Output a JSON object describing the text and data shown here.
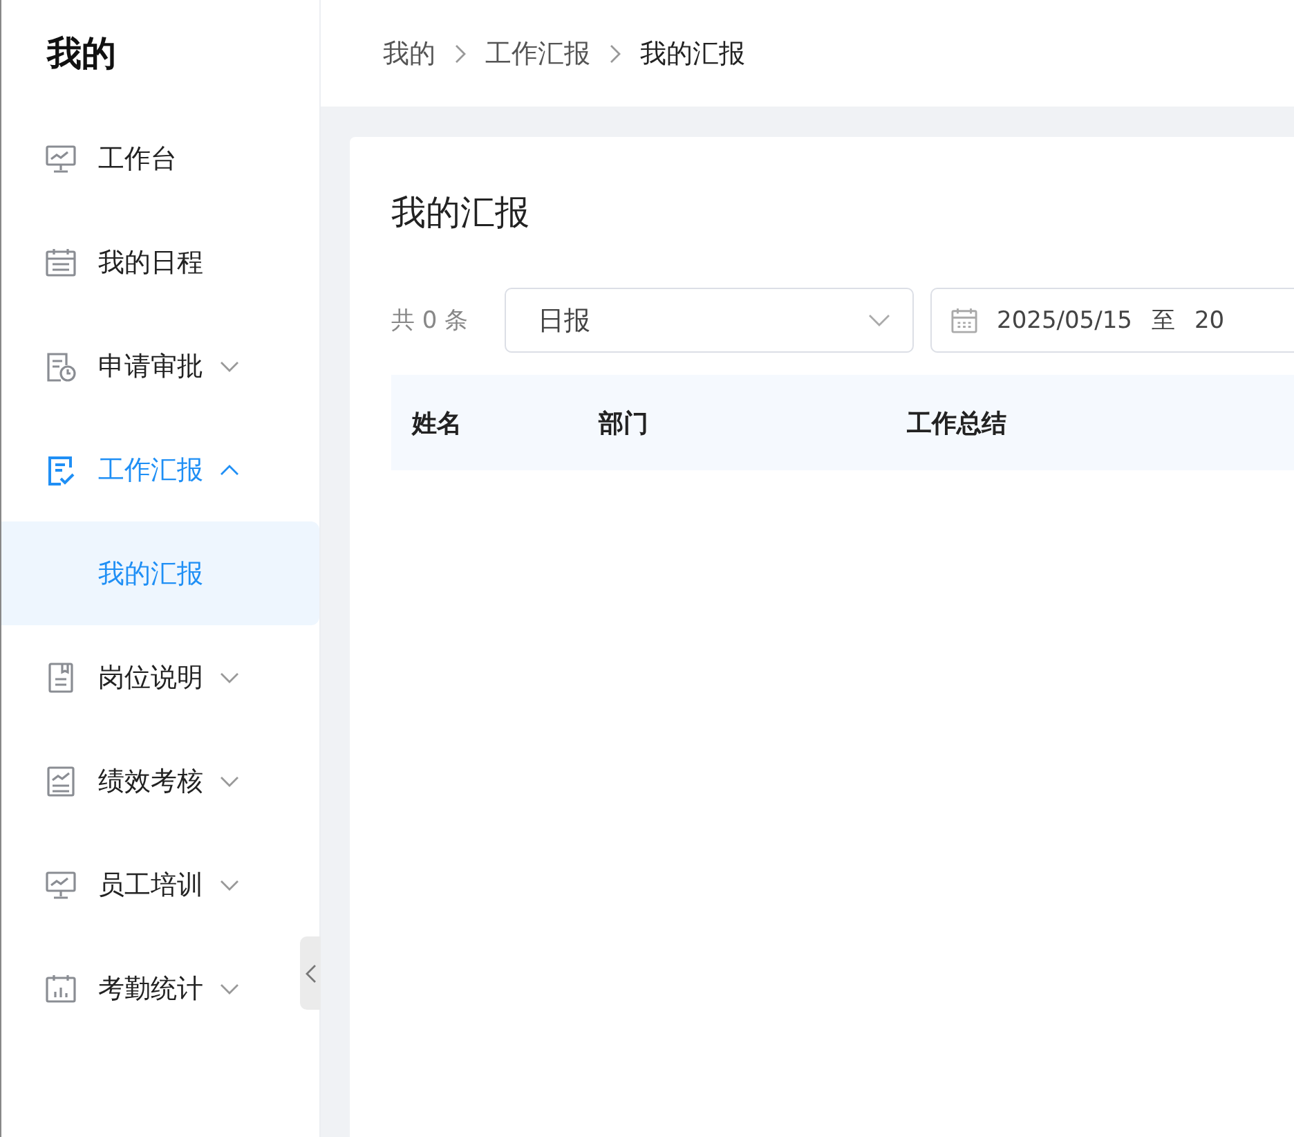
{
  "sidebar": {
    "title": "我的",
    "items": [
      {
        "label": "工作台",
        "selected": false
      },
      {
        "label": "我的日程",
        "selected": false
      },
      {
        "label": "申请审批",
        "selected": false,
        "expanded": false
      },
      {
        "label": "工作汇报",
        "selected": false,
        "expanded": true,
        "children": [
          {
            "label": "我的汇报",
            "selected": true
          }
        ]
      },
      {
        "label": "岗位说明",
        "selected": false,
        "expanded": false
      },
      {
        "label": "绩效考核",
        "selected": false,
        "expanded": false
      },
      {
        "label": "员工培训",
        "selected": false,
        "expanded": false
      },
      {
        "label": "考勤统计",
        "selected": false,
        "expanded": false
      }
    ]
  },
  "breadcrumb": [
    "我的",
    "工作汇报",
    "我的汇报"
  ],
  "page_title": "我的汇报",
  "filters": {
    "count": "共 0 条",
    "report_type": "日报",
    "date_start": "2025/05/15",
    "date_separator": "至",
    "date_end": "20"
  },
  "table": {
    "columns": [
      "姓名",
      "部门",
      "工作总结"
    ]
  }
}
